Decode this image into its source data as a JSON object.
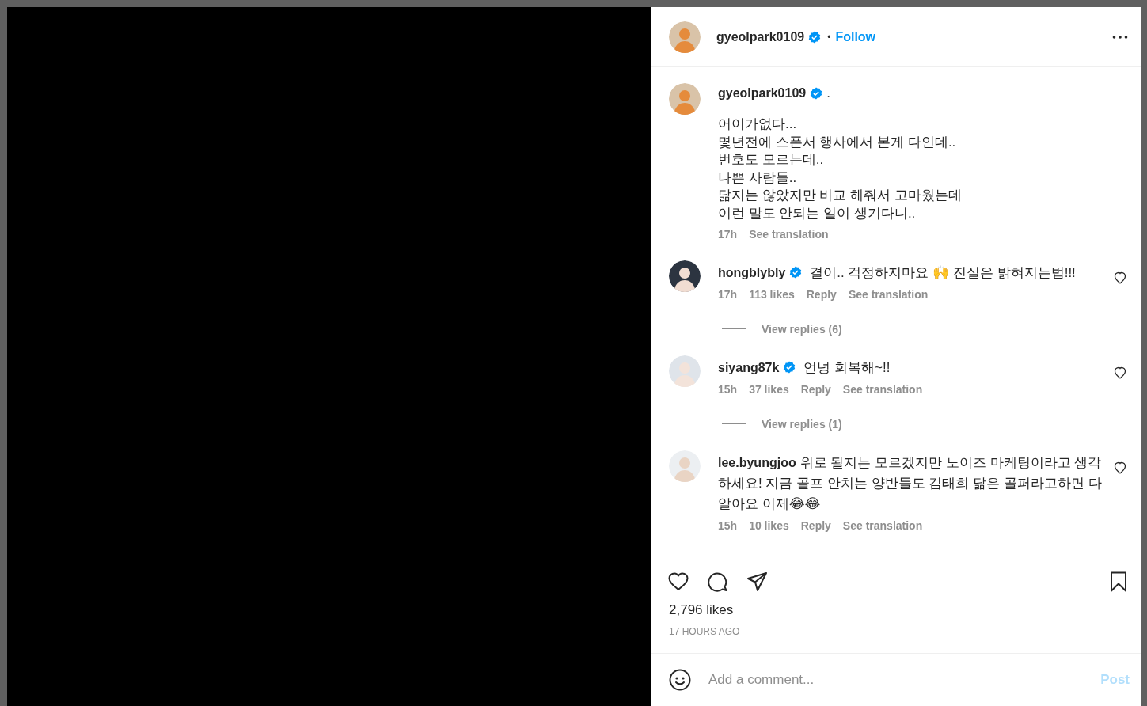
{
  "media": {
    "kind": "video"
  },
  "header": {
    "username": "gyeolpark0109",
    "verified": true,
    "separator": "•",
    "follow": "Follow"
  },
  "caption": {
    "username": "gyeolpark0109",
    "verified": true,
    "title": ".",
    "text": "어이가없다...\n몇년전에 스폰서 행사에서 본게 다인데..\n번호도 모르는데..\n나쁜 사람들..\n닮지는 않았지만 비교 해줘서 고마웠는데\n이런 말도 안되는 일이 생기다니..",
    "time": "17h",
    "see_translation": "See translation"
  },
  "comments": [
    {
      "username": "hongblybly",
      "verified": true,
      "text": "결이.. 걱정하지마요 🙌 진실은 밝혀지는법!!!",
      "time": "17h",
      "likes": "113 likes",
      "reply": "Reply",
      "see_translation": "See translation",
      "liked": false,
      "view_replies": "View replies (6)"
    },
    {
      "username": "siyang87k",
      "verified": true,
      "text": "언넝 회복해~!!",
      "time": "15h",
      "likes": "37 likes",
      "reply": "Reply",
      "see_translation": "See translation",
      "liked": false,
      "view_replies": "View replies (1)"
    },
    {
      "username": "lee.byungjoo",
      "verified": false,
      "text": "위로 될지는 모르겠지만 노이즈 마케팅이라고 생각하세요! 지금 골프 안치는 양반들도 김태희 닮은 골퍼라고하면 다알아요 이제😂😂",
      "time": "15h",
      "likes": "10 likes",
      "reply": "Reply",
      "see_translation": "See translation",
      "liked": false
    }
  ],
  "actions": {
    "liked": false,
    "saved": false
  },
  "likes": "2,796 likes",
  "posted": "17 HOURS AGO",
  "comment_box": {
    "placeholder": "Add a comment...",
    "post": "Post",
    "disabled": true
  }
}
